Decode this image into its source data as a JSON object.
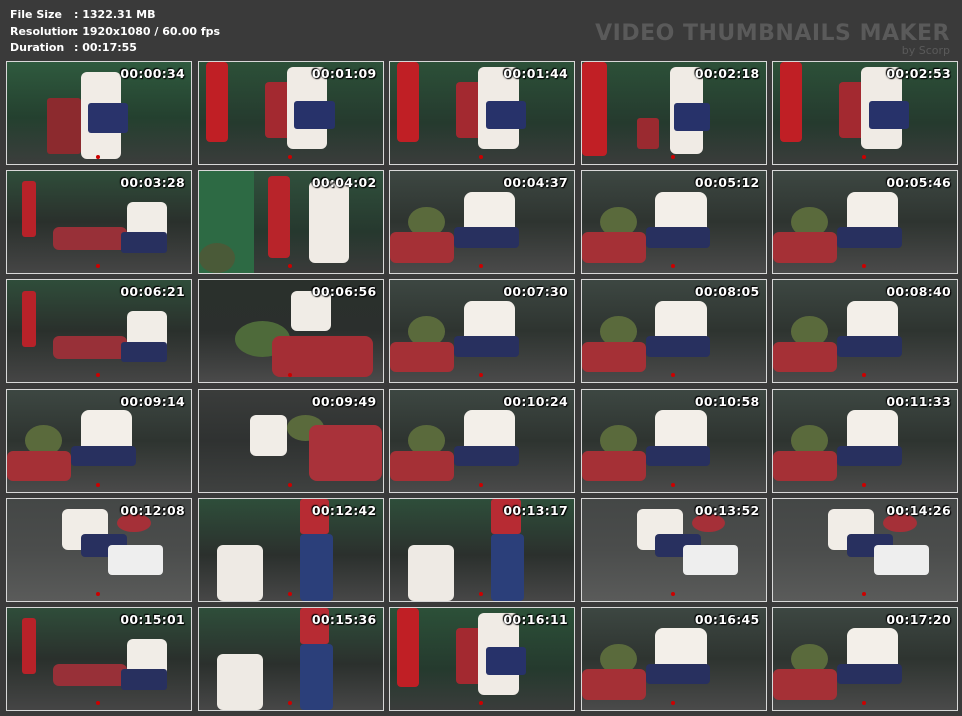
{
  "info": {
    "file_size_label": "File Size",
    "file_size_value": ": 1322.31 MB",
    "resolution_label": "Resolution",
    "resolution_value": ": 1920x1080 / 60.00 fps",
    "duration_label": "Duration",
    "duration_value": ": 00:17:55"
  },
  "brand": {
    "title": "VIDEO THUMBNAILS MAKER",
    "subtitle": "by Scorp"
  },
  "thumbnails": [
    {
      "time": "00:00:34",
      "scene": "standing-red"
    },
    {
      "time": "00:01:09",
      "scene": "red-bag"
    },
    {
      "time": "00:01:44",
      "scene": "red-bag"
    },
    {
      "time": "00:02:18",
      "scene": "red-bag-left"
    },
    {
      "time": "00:02:53",
      "scene": "red-bag"
    },
    {
      "time": "00:03:28",
      "scene": "floor-red"
    },
    {
      "time": "00:04:02",
      "scene": "green-bag"
    },
    {
      "time": "00:04:37",
      "scene": "floor-sit"
    },
    {
      "time": "00:05:12",
      "scene": "floor-sit"
    },
    {
      "time": "00:05:46",
      "scene": "floor-sit"
    },
    {
      "time": "00:06:21",
      "scene": "floor-red"
    },
    {
      "time": "00:06:56",
      "scene": "floor-green"
    },
    {
      "time": "00:07:30",
      "scene": "floor-sit"
    },
    {
      "time": "00:08:05",
      "scene": "floor-sit"
    },
    {
      "time": "00:08:40",
      "scene": "floor-sit"
    },
    {
      "time": "00:09:14",
      "scene": "floor-sit"
    },
    {
      "time": "00:09:49",
      "scene": "floor-dark"
    },
    {
      "time": "00:10:24",
      "scene": "floor-sit"
    },
    {
      "time": "00:10:58",
      "scene": "floor-sit"
    },
    {
      "time": "00:11:33",
      "scene": "floor-sit"
    },
    {
      "time": "00:12:08",
      "scene": "floor-light"
    },
    {
      "time": "00:12:42",
      "scene": "standing-blue"
    },
    {
      "time": "00:13:17",
      "scene": "standing-blue"
    },
    {
      "time": "00:13:52",
      "scene": "floor-light"
    },
    {
      "time": "00:14:26",
      "scene": "floor-light"
    },
    {
      "time": "00:15:01",
      "scene": "floor-red"
    },
    {
      "time": "00:15:36",
      "scene": "standing-blue"
    },
    {
      "time": "00:16:11",
      "scene": "red-bag"
    },
    {
      "time": "00:16:45",
      "scene": "floor-sit"
    },
    {
      "time": "00:17:20",
      "scene": "floor-sit"
    }
  ],
  "colors": {
    "background": "#3a3a3a",
    "thumb_border": "#d8d8d8",
    "brand_text": "#5a5a5a"
  }
}
